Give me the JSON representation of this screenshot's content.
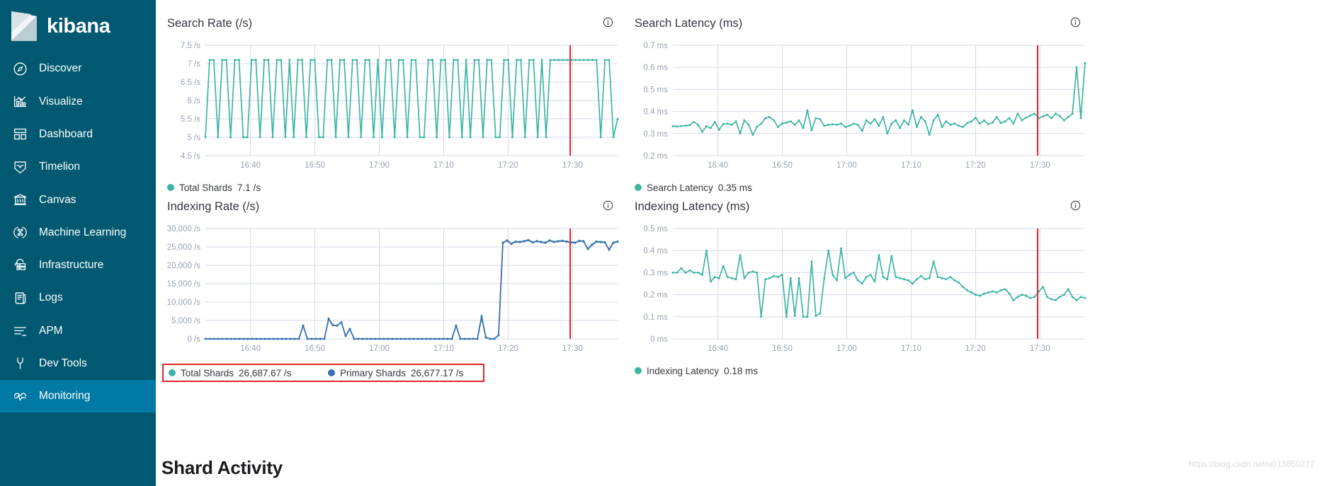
{
  "brand": {
    "name": "kibana",
    "logo_icon": "kibana-logo-icon"
  },
  "sidebar": {
    "background_color": "#015971",
    "active_color": "#0079a5",
    "items": [
      {
        "label": "Discover",
        "icon": "compass-icon",
        "active": false
      },
      {
        "label": "Visualize",
        "icon": "bar-chart-icon",
        "active": false
      },
      {
        "label": "Dashboard",
        "icon": "dashboard-grid-icon",
        "active": false
      },
      {
        "label": "Timelion",
        "icon": "timelion-icon",
        "active": false
      },
      {
        "label": "Canvas",
        "icon": "canvas-icon",
        "active": false
      },
      {
        "label": "Machine Learning",
        "icon": "machine-learning-icon",
        "active": false
      },
      {
        "label": "Infrastructure",
        "icon": "infrastructure-icon",
        "active": false
      },
      {
        "label": "Logs",
        "icon": "logs-icon",
        "active": false
      },
      {
        "label": "APM",
        "icon": "apm-icon",
        "active": false
      },
      {
        "label": "Dev Tools",
        "icon": "wrench-icon",
        "active": false
      },
      {
        "label": "Monitoring",
        "icon": "monitoring-icon",
        "active": true
      }
    ]
  },
  "main": {
    "section_heading": "Shard Activity",
    "watermark": "https://blog.csdn.net/u013850277",
    "info_icon": "info-circle-icon",
    "series_colors": {
      "total_shards": "#3eb5a3",
      "primary_shards": "#3b6eb5",
      "marker_line": "#e0242a"
    }
  },
  "chart_data": [
    {
      "id": "search-rate",
      "type": "line",
      "title": "Search Rate (/s)",
      "xlabel": "",
      "ylabel": "",
      "ylim": [
        4.5,
        7.5
      ],
      "ytick_labels": [
        "7.5 /s",
        "7 /s",
        "6.5 /s",
        "6 /s",
        "5.5 /s",
        "5 /s",
        "4.5 /s"
      ],
      "ytick_values": [
        7.5,
        7,
        6.5,
        6,
        5.5,
        5,
        4.5
      ],
      "xtick_labels": [
        "16:40",
        "16:50",
        "17:00",
        "17:10",
        "17:20",
        "17:30"
      ],
      "grid": true,
      "legend_position": "bottom",
      "marker_line_time": "17:28",
      "series": [
        {
          "name": "Total Shards",
          "color": "#3eb5a3",
          "current_value": "7.1 /s",
          "values": [
            5,
            7.1,
            7.1,
            5,
            7.1,
            7.1,
            5,
            7.1,
            7.1,
            5,
            5,
            7.1,
            7.1,
            5,
            7.1,
            7.1,
            5,
            7.1,
            7.1,
            5,
            7.1,
            5,
            7.1,
            7.1,
            5,
            7.1,
            7.1,
            5,
            5,
            7.1,
            7.1,
            5,
            7.1,
            7.1,
            5,
            7.1,
            7.1,
            5,
            7.1,
            7.1,
            5,
            7.1,
            5,
            7.1,
            7.1,
            5,
            7.1,
            7.1,
            5,
            7.1,
            7.1,
            5,
            5,
            7.1,
            7.1,
            5,
            7.1,
            7.1,
            5,
            7.1,
            7.1,
            5,
            7.1,
            5,
            7.1,
            7.1,
            5,
            7.1,
            7.1,
            5,
            5,
            7.1,
            7.1,
            5,
            7.1,
            7.1,
            5,
            7.1,
            7.1,
            5,
            7.1,
            5,
            7.1,
            7.1,
            7.1,
            7.1,
            7.1,
            7.1,
            7.1,
            7.1,
            7.1,
            7.1,
            7.1,
            7.1,
            5,
            7.1,
            7.1,
            5,
            5.5
          ]
        }
      ]
    },
    {
      "id": "search-latency",
      "type": "line",
      "title": "Search Latency (ms)",
      "xlabel": "",
      "ylabel": "",
      "ylim": [
        0.2,
        0.7
      ],
      "ytick_labels": [
        "0.7 ms",
        "0.6 ms",
        "0.5 ms",
        "0.4 ms",
        "0.3 ms",
        "0.2 ms"
      ],
      "ytick_values": [
        0.7,
        0.6,
        0.5,
        0.4,
        0.3,
        0.2
      ],
      "xtick_labels": [
        "16:40",
        "16:50",
        "17:00",
        "17:10",
        "17:20",
        "17:30"
      ],
      "grid": true,
      "legend_position": "bottom",
      "marker_line_time": "17:28",
      "series": [
        {
          "name": "Search Latency",
          "color": "#3eb5a3",
          "current_value": "0.35 ms",
          "values": [
            0.333,
            0.332,
            0.334,
            0.336,
            0.338,
            0.352,
            0.34,
            0.308,
            0.333,
            0.325,
            0.353,
            0.317,
            0.343,
            0.345,
            0.34,
            0.355,
            0.3,
            0.36,
            0.34,
            0.295,
            0.33,
            0.345,
            0.37,
            0.375,
            0.36,
            0.33,
            0.345,
            0.35,
            0.355,
            0.34,
            0.36,
            0.325,
            0.405,
            0.315,
            0.37,
            0.365,
            0.335,
            0.34,
            0.342,
            0.34,
            0.345,
            0.33,
            0.335,
            0.345,
            0.34,
            0.312,
            0.36,
            0.345,
            0.365,
            0.335,
            0.375,
            0.3,
            0.345,
            0.36,
            0.325,
            0.36,
            0.34,
            0.405,
            0.33,
            0.375,
            0.355,
            0.295,
            0.36,
            0.385,
            0.33,
            0.355,
            0.34,
            0.345,
            0.335,
            0.33,
            0.348,
            0.355,
            0.372,
            0.345,
            0.36,
            0.342,
            0.35,
            0.375,
            0.348,
            0.355,
            0.37,
            0.345,
            0.39,
            0.36,
            0.372,
            0.382,
            0.39,
            0.37,
            0.378,
            0.385,
            0.37,
            0.39,
            0.38,
            0.36,
            0.375,
            0.39,
            0.6,
            0.37,
            0.62
          ]
        }
      ]
    },
    {
      "id": "indexing-rate",
      "type": "line",
      "title": "Indexing Rate (/s)",
      "xlabel": "",
      "ylabel": "",
      "ylim": [
        0,
        30000
      ],
      "ytick_labels": [
        "30,000 /s",
        "25,000 /s",
        "20,000 /s",
        "15,000 /s",
        "10,000 /s",
        "5,000 /s",
        "0 /s"
      ],
      "ytick_values": [
        30000,
        25000,
        20000,
        15000,
        10000,
        5000,
        0
      ],
      "xtick_labels": [
        "16:40",
        "16:50",
        "17:00",
        "17:10",
        "17:20",
        "17:30"
      ],
      "grid": true,
      "legend_position": "bottom",
      "legend_highlighted": true,
      "marker_line_time": "17:28",
      "series": [
        {
          "name": "Total Shards",
          "color": "#3eb5a3",
          "current_value": "26,687.67 /s",
          "values": [
            0,
            0,
            0,
            0,
            0,
            0,
            0,
            0,
            0,
            0,
            0,
            0,
            0,
            0,
            0,
            0,
            0,
            0,
            0,
            0,
            0,
            0,
            0,
            3600,
            0,
            0,
            0,
            0,
            0,
            5500,
            3700,
            3600,
            4500,
            800,
            2700,
            0,
            0,
            0,
            0,
            0,
            0,
            0,
            0,
            0,
            0,
            0,
            0,
            0,
            0,
            0,
            0,
            0,
            0,
            0,
            0,
            0,
            0,
            0,
            0,
            3600,
            0,
            0,
            0,
            0,
            0,
            6300,
            400,
            0,
            0,
            1000,
            26200,
            26800,
            25900,
            26500,
            26400,
            26600,
            26900,
            26300,
            26600,
            26400,
            26200,
            26800,
            26400,
            26600,
            26700,
            26500,
            26300,
            26200,
            26700,
            26600,
            24500,
            25700,
            26500,
            26400,
            26300,
            24300,
            26200,
            26500
          ]
        },
        {
          "name": "Primary Shards",
          "color": "#3b6eb5",
          "current_value": "26,677.17 /s",
          "values": [
            0,
            0,
            0,
            0,
            0,
            0,
            0,
            0,
            0,
            0,
            0,
            0,
            0,
            0,
            0,
            0,
            0,
            0,
            0,
            0,
            0,
            0,
            0,
            3600,
            0,
            0,
            0,
            0,
            0,
            5500,
            3700,
            3600,
            4500,
            800,
            2700,
            0,
            0,
            0,
            0,
            0,
            0,
            0,
            0,
            0,
            0,
            0,
            0,
            0,
            0,
            0,
            0,
            0,
            0,
            0,
            0,
            0,
            0,
            0,
            0,
            3600,
            0,
            0,
            0,
            0,
            0,
            5800,
            400,
            0,
            0,
            1000,
            26100,
            26700,
            25800,
            26400,
            26300,
            26500,
            26800,
            26200,
            26500,
            26300,
            26100,
            26700,
            26300,
            26500,
            26600,
            26400,
            26200,
            26100,
            26600,
            26500,
            24400,
            25600,
            26400,
            26300,
            26200,
            24200,
            26100,
            26400
          ]
        }
      ]
    },
    {
      "id": "indexing-latency",
      "type": "line",
      "title": "Indexing Latency (ms)",
      "xlabel": "",
      "ylabel": "",
      "ylim": [
        0,
        0.5
      ],
      "ytick_labels": [
        "0.5 ms",
        "0.4 ms",
        "0.3 ms",
        "0.2 ms",
        "0.1 ms",
        "0 ms"
      ],
      "ytick_values": [
        0.5,
        0.4,
        0.3,
        0.2,
        0.1,
        0
      ],
      "xtick_labels": [
        "16:40",
        "16:50",
        "17:00",
        "17:10",
        "17:20",
        "17:30"
      ],
      "grid": true,
      "legend_position": "bottom",
      "marker_line_time": "17:28",
      "series": [
        {
          "name": "Indexing Latency",
          "color": "#3eb5a3",
          "current_value": "0.18 ms",
          "values": [
            0.3,
            0.3,
            0.32,
            0.3,
            0.31,
            0.3,
            0.3,
            0.29,
            0.4,
            0.26,
            0.28,
            0.275,
            0.33,
            0.28,
            0.275,
            0.27,
            0.38,
            0.275,
            0.3,
            0.305,
            0.3,
            0.1,
            0.27,
            0.275,
            0.285,
            0.28,
            0.29,
            0.1,
            0.275,
            0.105,
            0.275,
            0.1,
            0.1,
            0.35,
            0.105,
            0.115,
            0.275,
            0.4,
            0.29,
            0.265,
            0.41,
            0.275,
            0.29,
            0.3,
            0.265,
            0.25,
            0.28,
            0.29,
            0.26,
            0.38,
            0.28,
            0.27,
            0.375,
            0.28,
            0.275,
            0.27,
            0.265,
            0.25,
            0.27,
            0.285,
            0.27,
            0.275,
            0.35,
            0.28,
            0.275,
            0.27,
            0.28,
            0.265,
            0.255,
            0.235,
            0.22,
            0.21,
            0.2,
            0.195,
            0.205,
            0.21,
            0.215,
            0.21,
            0.22,
            0.225,
            0.205,
            0.175,
            0.19,
            0.2,
            0.195,
            0.185,
            0.19,
            0.215,
            0.235,
            0.19,
            0.18,
            0.175,
            0.19,
            0.2,
            0.225,
            0.19,
            0.175,
            0.19,
            0.185
          ]
        }
      ]
    }
  ]
}
